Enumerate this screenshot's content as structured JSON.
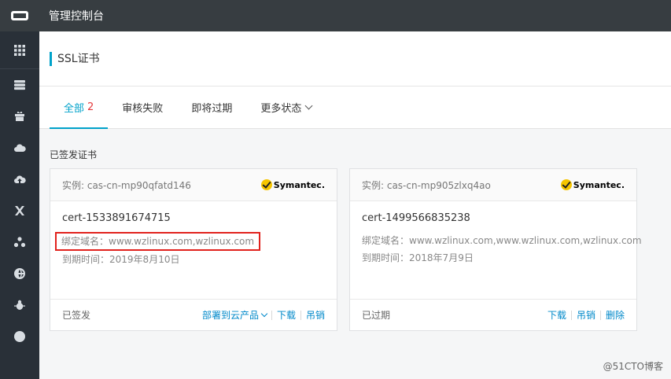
{
  "topbar": {
    "title": "管理控制台",
    "logo_icon": "aliyun-logo-icon"
  },
  "sidebar": {
    "icons": [
      "grid-icon",
      "database-icon",
      "gift-icon",
      "cloud-icon",
      "cloud-upload-icon",
      "network-icon",
      "cluster-icon",
      "globe-icon",
      "bug-icon",
      "circle-icon"
    ]
  },
  "page": {
    "title": "SSL证书"
  },
  "tabs": [
    {
      "label": "全部",
      "count": "2"
    },
    {
      "label": "审核失败"
    },
    {
      "label": "即将过期"
    },
    {
      "label": "更多状态"
    }
  ],
  "section_label": "已签发证书",
  "cards": [
    {
      "instance": "实例: cas-cn-mp90qfatd146",
      "brand": "Symantec.",
      "cert_name": "cert-1533891674715",
      "domain_label": "绑定域名：",
      "domain_value": "www.wzlinux.com,wzlinux.com",
      "expire_label": "到期时间：",
      "expire_value": "2019年8月10日",
      "status": "已签发",
      "actions": [
        "部署到云产品",
        "下载",
        "吊销"
      ]
    },
    {
      "instance": "实例: cas-cn-mp905zlxq4ao",
      "brand": "Symantec.",
      "cert_name": "cert-1499566835238",
      "domain_label": "绑定域名：",
      "domain_value": "www.wzlinux.com,www.wzlinux.com,wzlinux.com",
      "expire_label": "到期时间：",
      "expire_value": "2018年7月9日",
      "status": "已过期",
      "actions": [
        "下载",
        "吊销",
        "删除"
      ]
    }
  ],
  "watermark": "@51CTO博客",
  "colors": {
    "accent": "#00a2ca",
    "link": "#0089ca",
    "count": "#e4393c",
    "highlight_box": "#e1221d",
    "topbar": "#373d41",
    "sidebar": "#293038"
  }
}
